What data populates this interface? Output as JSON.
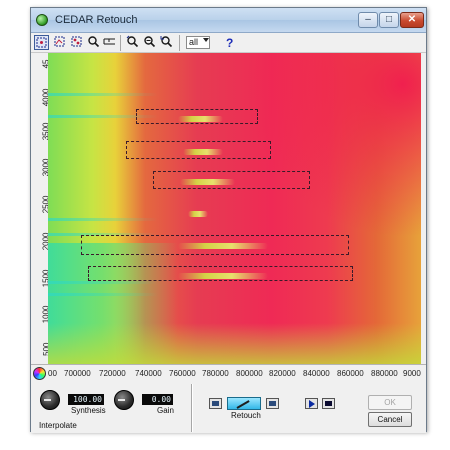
{
  "window": {
    "title": "CEDAR Retouch",
    "controls": {
      "minimize": "–",
      "maximize": "□",
      "close": "✕"
    }
  },
  "toolbar": {
    "view_select": "all",
    "help": "?",
    "tools": [
      "select-rect-tool",
      "select-harmonic-tool",
      "select-lasso-tool",
      "zoom-tool",
      "ruler-tool",
      "zoom-fit-tool",
      "zoom-out-tool",
      "zoom-undo-tool"
    ]
  },
  "y_axis": {
    "ticks": [
      "500",
      "1000",
      "1500",
      "2000",
      "2500",
      "3000",
      "3500",
      "4000",
      "45"
    ]
  },
  "x_axis": {
    "ticks": [
      "700000",
      "720000",
      "740000",
      "760000",
      "780000",
      "800000",
      "820000",
      "840000",
      "860000",
      "880000",
      "9000"
    ],
    "first_label": "00"
  },
  "controls": {
    "synthesis_value": "100.00",
    "synthesis_label": "Synthesis",
    "gain_value": "0.00",
    "gain_label": "Gain",
    "interpolate_label": "Interpolate",
    "retouch_label": "Retouch",
    "ok_label": "OK",
    "cancel_label": "Cancel"
  },
  "colors": {
    "accent": "#33b8e8",
    "hot": "#ef2a55",
    "cool": "#35dca5"
  }
}
